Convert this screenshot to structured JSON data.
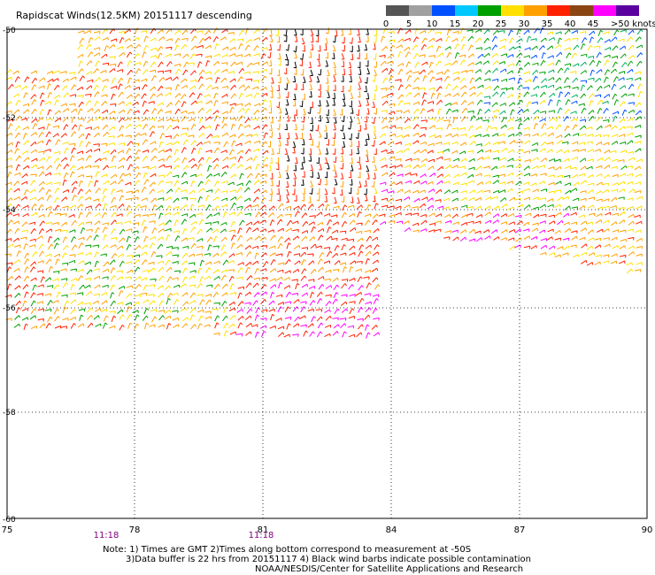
{
  "title": "Rapidscat Winds(12.5KM) 20151117 descending",
  "colorbar": {
    "labels": [
      "0",
      "5",
      "10",
      "15",
      "20",
      "25",
      "30",
      "35",
      "40",
      "45",
      ">50 knots"
    ],
    "colors": [
      "#555555",
      "#a0a0a0",
      "#0050ff",
      "#00c8ff",
      "#00a000",
      "#ffe000",
      "#ffa000",
      "#ff2000",
      "#8b4513",
      "#ff00ff",
      "#5a00a0"
    ]
  },
  "map": {
    "lon_ticks": [
      "75",
      "78",
      "81",
      "84",
      "87",
      "90"
    ],
    "lat_ticks": [
      "-50",
      "-52",
      "-54",
      "-56",
      "-58",
      "-60"
    ],
    "time_labels": [
      "11:18",
      "11:18"
    ]
  },
  "notes": {
    "line1": "Note: 1) Times are GMT 2)Times along bottom correspond to measurement at -50S",
    "line2": "3)Data buffer is 22 hrs from 20151117 4) Black wind barbs indicate possible contamination",
    "line3": "NOAA/NESDIS/Center for Satellite Applications and Research"
  }
}
